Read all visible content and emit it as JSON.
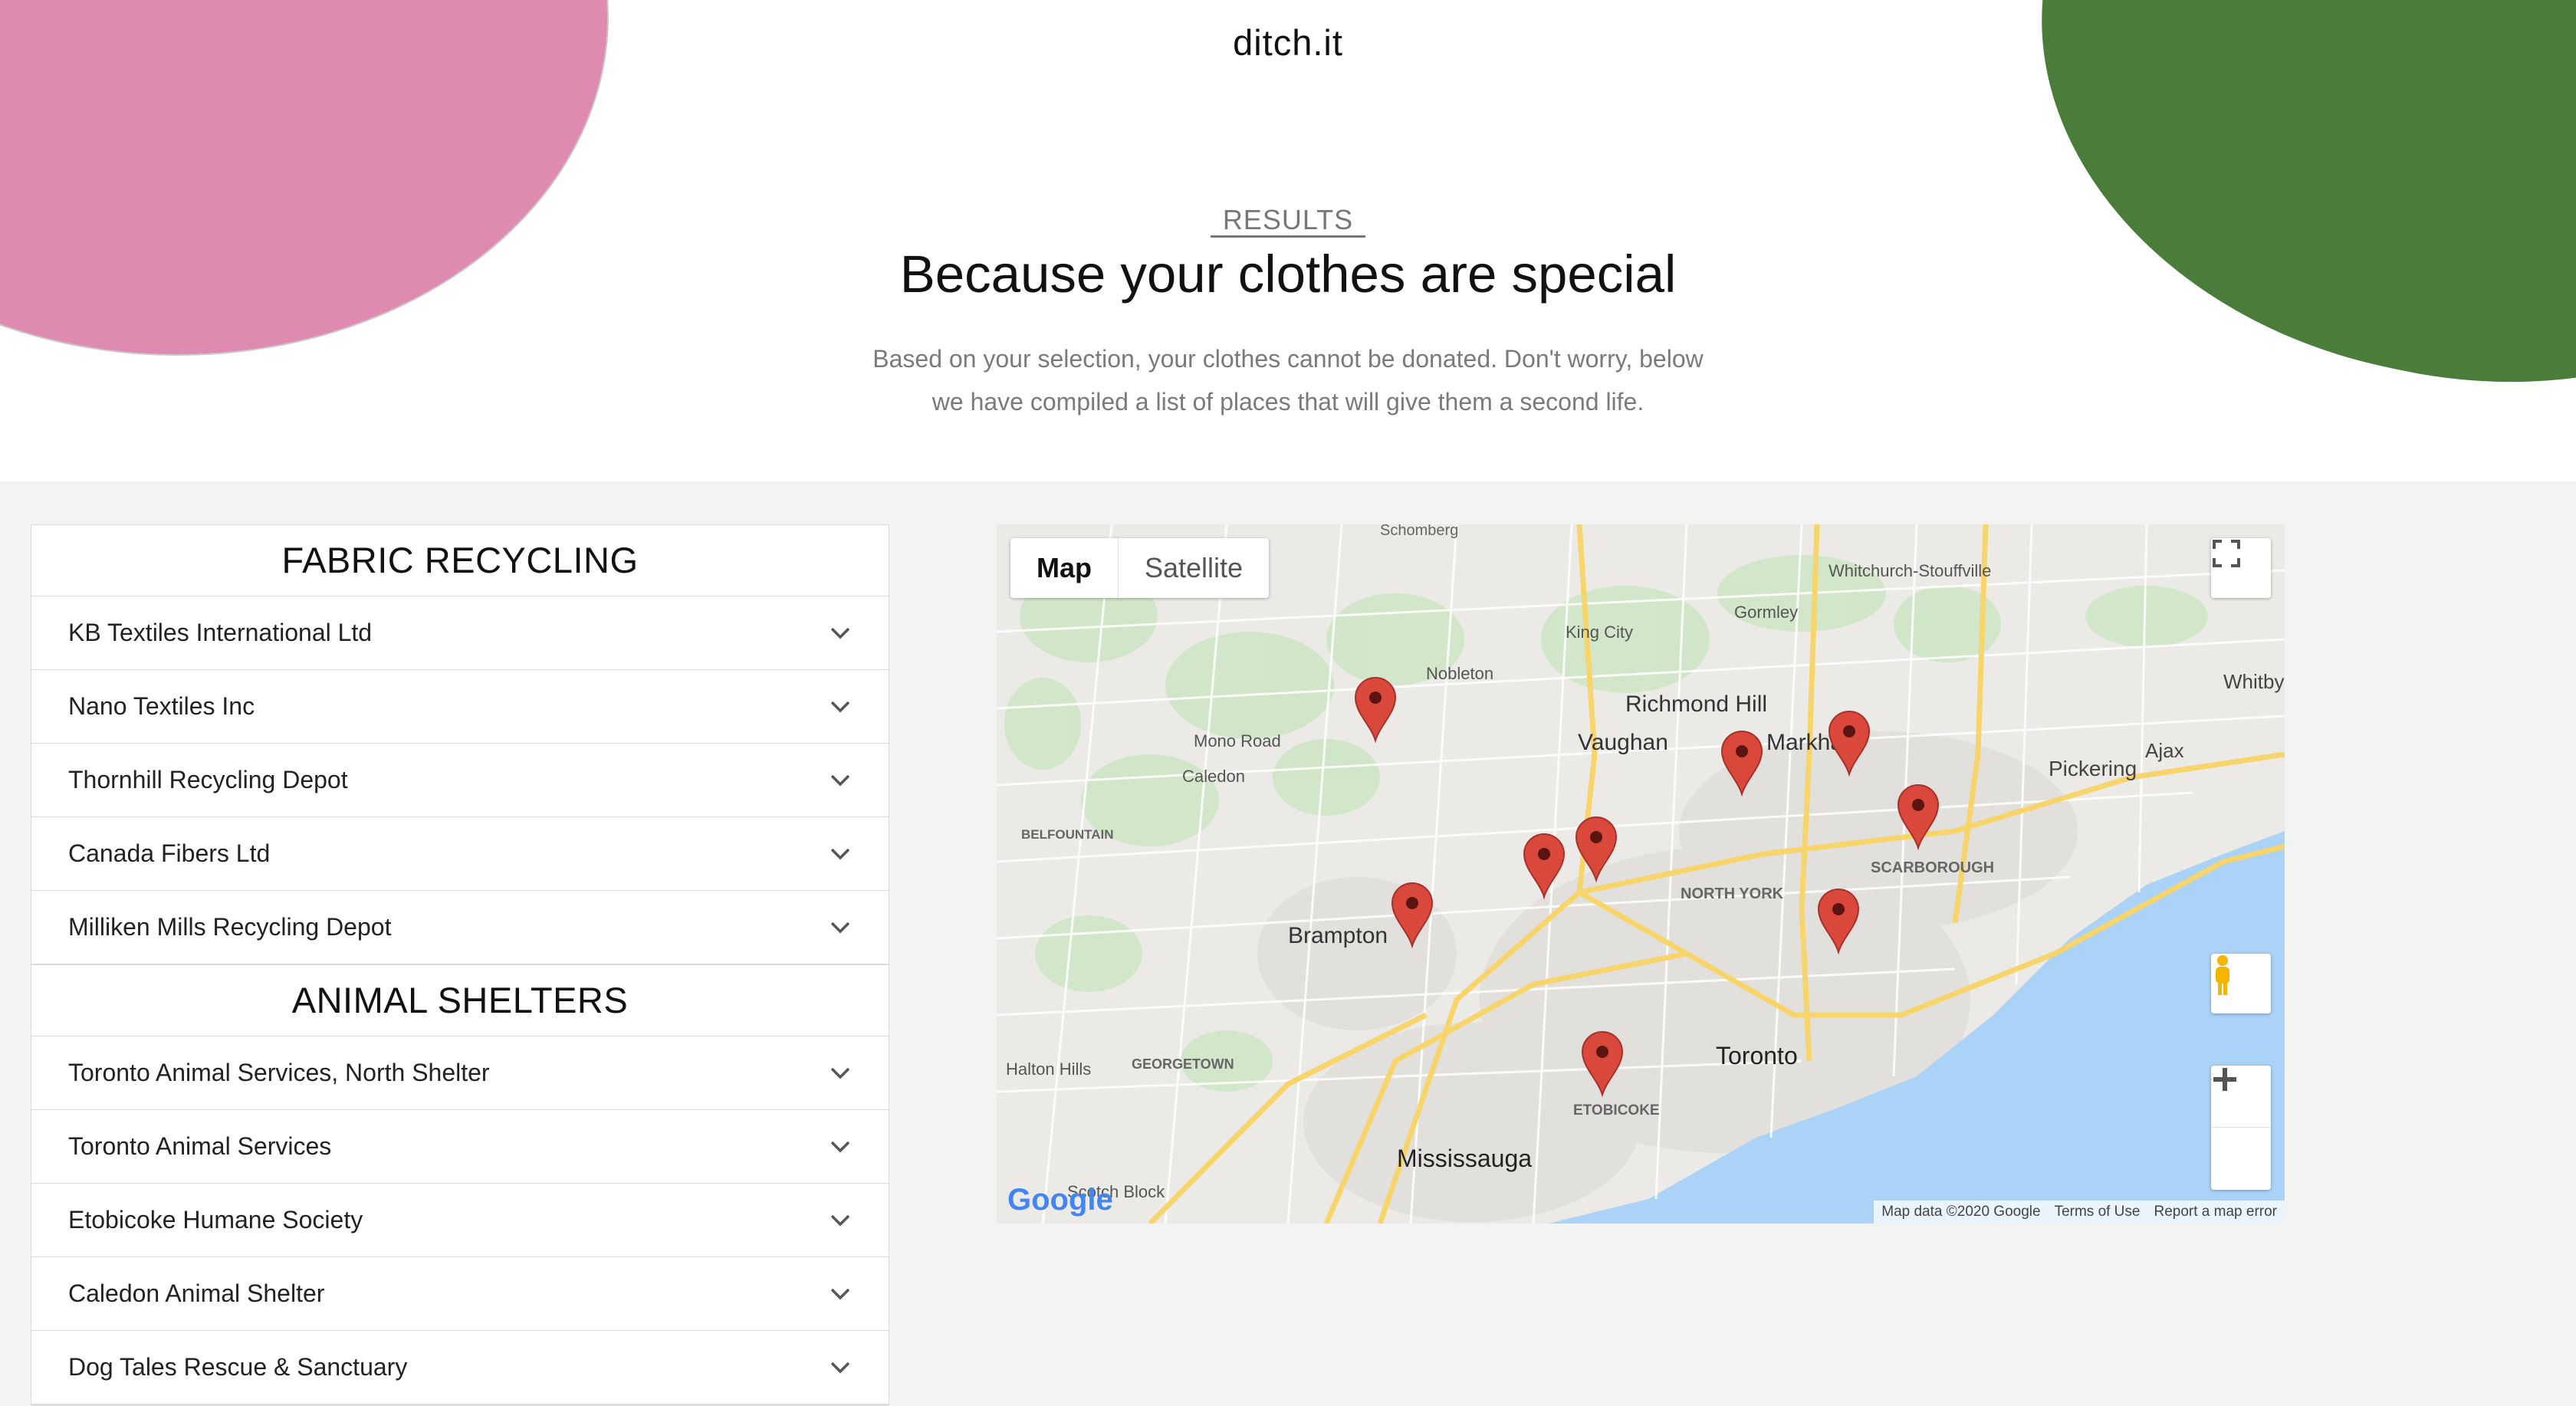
{
  "brand": "ditch.it",
  "hero": {
    "eyebrow": "RESULTS",
    "title": "Because your clothes are special",
    "subtitle_line1": "Based on your selection, your clothes cannot be donated. Don't worry, below",
    "subtitle_line2": "we have compiled a list of places that will give them a second life."
  },
  "sections": [
    {
      "heading": "FABRIC RECYCLING",
      "items": [
        "KB Textiles International Ltd",
        "Nano Textiles Inc",
        "Thornhill Recycling Depot",
        "Canada Fibers Ltd",
        "Milliken Mills Recycling Depot"
      ]
    },
    {
      "heading": "ANIMAL SHELTERS",
      "items": [
        "Toronto Animal Services, North Shelter",
        "Toronto Animal Services",
        "Etobicoke Humane Society",
        "Caledon Animal Shelter",
        "Dog Tales Rescue & Sanctuary"
      ]
    }
  ],
  "map": {
    "type_map": "Map",
    "type_satellite": "Satellite",
    "attribution": "Map data ©2020 Google",
    "terms": "Terms of Use",
    "report": "Report a map error",
    "places": {
      "schomberg": "Schomberg",
      "whitchurch": "Whitchurch-Stouffville",
      "gormley": "Gormley",
      "king_city": "King City",
      "nobleton": "Nobleton",
      "richmond_hill": "Richmond Hill",
      "vaughan": "Vaughan",
      "markham": "Markham",
      "mono_road": "Mono Road",
      "caledon": "Caledon",
      "pickering": "Pickering",
      "ajax": "Ajax",
      "whitby": "Whitby",
      "belfountain": "BELFOUNTAIN",
      "scarborough": "SCARBOROUGH",
      "north_york": "NORTH YORK",
      "brampton": "Brampton",
      "halton_hills": "Halton Hills",
      "georgetown": "GEORGETOWN",
      "toronto": "Toronto",
      "etobicoke": "ETOBICOKE",
      "mississauga": "Mississauga",
      "scotch_block": "Scotch Block",
      "google": "Google"
    }
  },
  "colors": {
    "pink_blob": "#df8bb1",
    "green_blob": "#4a7d3a",
    "water": "#aad3f7",
    "marker": "#d9483b"
  }
}
